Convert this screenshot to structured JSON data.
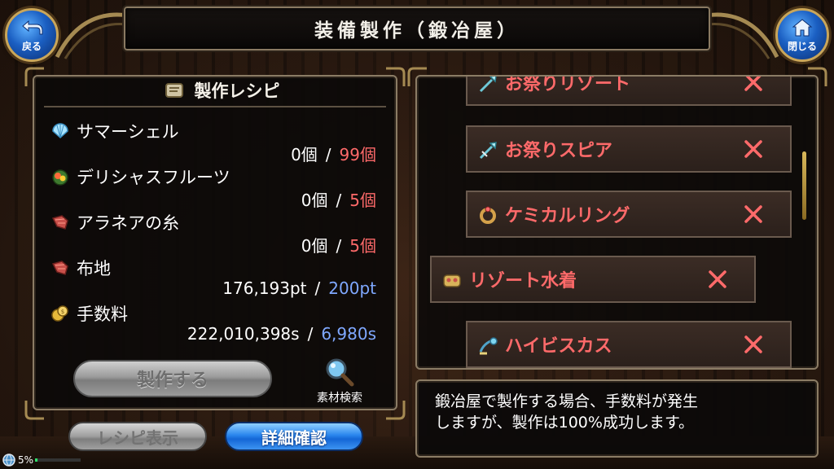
{
  "header": {
    "title": "装備製作（鍛冶屋）",
    "back_label": "戻る",
    "close_label": "閉じる"
  },
  "recipe": {
    "title": "製作レシピ",
    "materials": [
      {
        "name": "サマーシェル",
        "have": "0個",
        "need": "99個",
        "need_color": "red",
        "icon": "shell-icon"
      },
      {
        "name": "デリシャスフルーツ",
        "have": "0個",
        "need": "5個",
        "need_color": "red",
        "icon": "fruit-icon"
      },
      {
        "name": "アラネアの糸",
        "have": "0個",
        "need": "5個",
        "need_color": "red",
        "icon": "cloth-icon"
      },
      {
        "name": "布地",
        "have": "176,193pt",
        "need": "200pt",
        "need_color": "blue",
        "icon": "cloth-icon"
      },
      {
        "name": "手数料",
        "have": "222,010,398s",
        "need": "6,980s",
        "need_color": "blue",
        "icon": "coin-icon"
      }
    ],
    "separator": "/",
    "make_label": "製作する",
    "search_label": "素材検索"
  },
  "bottom_buttons": {
    "recipe_show": "レシピ表示",
    "detail": "詳細確認"
  },
  "list": {
    "items": [
      {
        "name": "お祭りリゾート",
        "icon": "spear-icon"
      },
      {
        "name": "お祭りスピア",
        "icon": "spear-icon"
      },
      {
        "name": "ケミカルリング",
        "icon": "ring-icon"
      },
      {
        "name": "リゾート水着",
        "icon": "swimsuit-icon",
        "selected": true
      },
      {
        "name": "ハイビスカス",
        "icon": "flower-icon"
      }
    ]
  },
  "message": {
    "line1": "鍛冶屋で製作する場合、手数料が発生",
    "line2": "しますが、製作は100%成功します。"
  },
  "status": {
    "percent_label": "5%",
    "progress": 0.05
  },
  "colors": {
    "need_red": "#ff6a6a",
    "need_blue": "#7fa8ff",
    "item_name_red": "#ff6a6a",
    "accent_blue": "#1b5fc2",
    "frame": "#8b7c65"
  }
}
